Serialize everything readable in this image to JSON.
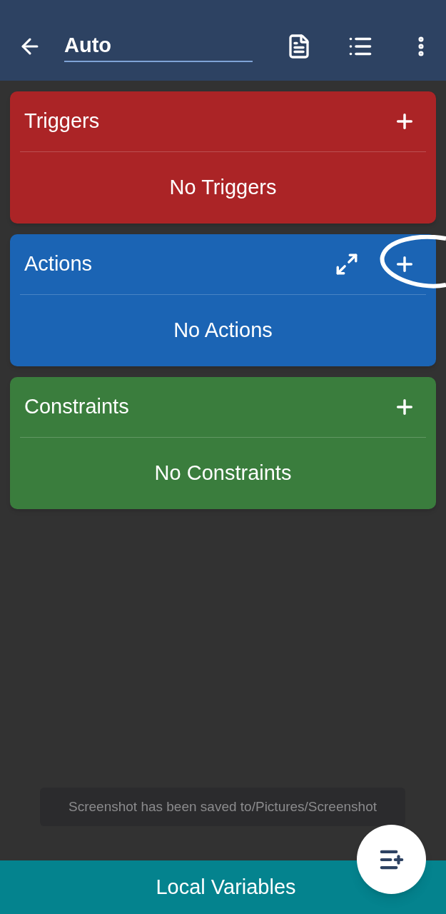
{
  "app_bar": {
    "title": "Auto"
  },
  "sections": [
    {
      "title": "Triggers",
      "empty_text": "No Triggers",
      "color": "#ab2426",
      "expandable": false,
      "highlighted": false
    },
    {
      "title": "Actions",
      "empty_text": "No Actions",
      "color": "#1b64b4",
      "expandable": true,
      "highlighted": true
    },
    {
      "title": "Constraints",
      "empty_text": "No Constraints",
      "color": "#3a7d3d",
      "expandable": false,
      "highlighted": false
    }
  ],
  "toast": "Screenshot has been saved to/Pictures/Screenshot",
  "bottom_bar": {
    "label": "Local Variables"
  }
}
